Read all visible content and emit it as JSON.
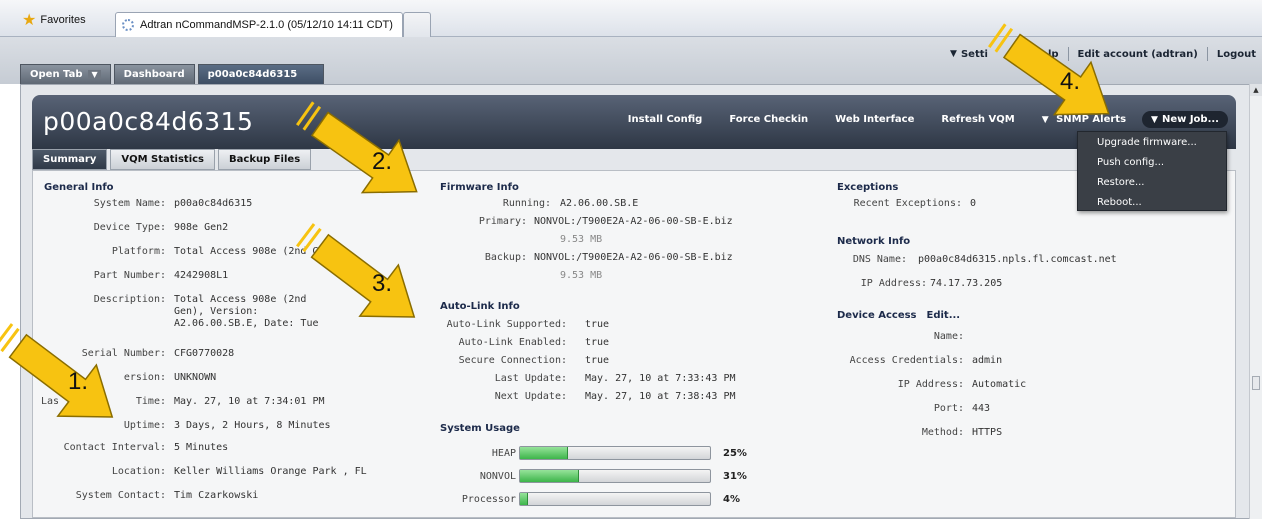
{
  "browser": {
    "favorites": "Favorites",
    "tab_title": "Adtran nCommandMSP-2.1.0 (05/12/10 14:11 CDT)"
  },
  "top_links": {
    "settings": "Setti",
    "help": "lp",
    "edit_account": "Edit account (adtran)",
    "logout": "Logout"
  },
  "app_tabs": [
    "Open Tab",
    "Dashboard",
    "p00a0c84d6315"
  ],
  "device": {
    "title": "p00a0c84d6315",
    "actions": [
      "Install Config",
      "Force Checkin",
      "Web Interface",
      "Refresh VQM",
      "SNMP Alerts"
    ],
    "new_job": "New Job...",
    "sub_tabs": [
      "Summary",
      "VQM Statistics",
      "Backup Files"
    ]
  },
  "menu": [
    "Upgrade firmware...",
    "Push config...",
    "Restore...",
    "Reboot..."
  ],
  "general_info": {
    "title": "General Info",
    "system_name_label": "System Name:",
    "system_name": "p00a0c84d6315",
    "device_type_label": "Device Type:",
    "device_type": "908e Gen2",
    "platform_label": "Platform:",
    "platform": "Total Access 908e (2nd Gen",
    "part_number_label": "Part Number:",
    "part_number": "4242908L1",
    "description_label": "Description:",
    "description_1": "Total Access 908e (2nd",
    "description_2": "Gen), Version:",
    "description_3": "A2.06.00.SB.E, Date: Tue",
    "serial_label": "Serial Number:",
    "serial": "CFG0770028",
    "hw_version_label": "ersion:",
    "hw_version": "UNKNOWN",
    "last_time_label_a": "Las",
    "last_time_label_b": "Time:",
    "last_time": "May. 27, 10 at 7:34:01 PM",
    "uptime_label": "Uptime:",
    "uptime": "3 Days, 2 Hours, 8 Minutes",
    "contact_interval_label": "Contact Interval:",
    "contact_interval": "5 Minutes",
    "location_label": "Location:",
    "location": "Keller Williams  Orange Park , FL",
    "system_contact_label": "System Contact:",
    "system_contact": "Tim Czarkowski"
  },
  "firmware_info": {
    "title": "Firmware Info",
    "running_label": "Running:",
    "running": "A2.06.00.SB.E",
    "primary_label": "Primary:",
    "primary": "NONVOL:/T900E2A-A2-06-00-SB-E.biz",
    "primary_size": "9.53 MB",
    "backup_label": "Backup:",
    "backup": "NONVOL:/T900E2A-A2-06-00-SB-E.biz",
    "backup_size": "9.53 MB"
  },
  "autolink_info": {
    "title": "Auto-Link Info",
    "supported_label": "Auto-Link Supported:",
    "supported": "true",
    "enabled_label": "Auto-Link Enabled:",
    "enabled": "true",
    "secure_label": "Secure Connection:",
    "secure": "true",
    "last_update_label": "Last Update:",
    "last_update": "May. 27, 10 at 7:33:43 PM",
    "next_update_label": "Next Update:",
    "next_update": "May. 27, 10 at 7:38:43 PM"
  },
  "system_usage": {
    "title": "System Usage",
    "items": [
      {
        "label": "HEAP",
        "percent_text": "25%",
        "fraction": 0.25
      },
      {
        "label": "NONVOL",
        "percent_text": "31%",
        "fraction": 0.31
      },
      {
        "label": "Processor",
        "percent_text": "4%",
        "fraction": 0.04
      }
    ]
  },
  "exceptions": {
    "title": "Exceptions",
    "recent_label": "Recent Exceptions:",
    "recent": "0"
  },
  "network_info": {
    "title": "Network Info",
    "dns_label": "DNS Name:",
    "dns": "p00a0c84d6315.npls.fl.comcast.net",
    "ip_label": "IP Address:",
    "ip": "74.17.73.205"
  },
  "device_access": {
    "title": "Device Access",
    "edit": "Edit...",
    "name_label": "Name:",
    "name": "",
    "credentials_label": "Access Credentials:",
    "credentials": "admin",
    "ip_label": "IP Address:",
    "ip": "Automatic",
    "port_label": "Port:",
    "port": "443",
    "method_label": "Method:",
    "method": "HTTPS"
  },
  "annotations": [
    "1.",
    "2.",
    "3.",
    "4."
  ],
  "colors": {
    "arrow_fill": "#f7c311",
    "arrow_stroke": "#8a6d00",
    "bar_fill": "#4cc45a",
    "header": "#3a4454"
  }
}
